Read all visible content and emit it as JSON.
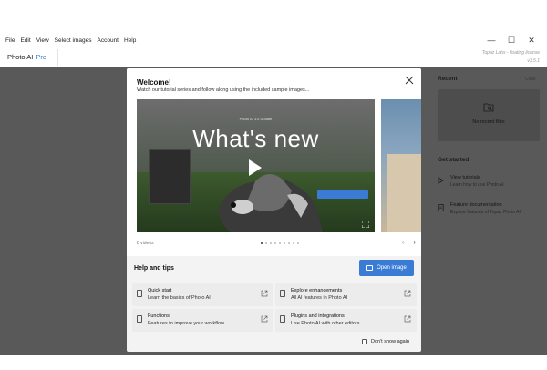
{
  "menu": [
    "File",
    "Edit",
    "View",
    "Select images",
    "Account",
    "Help"
  ],
  "window_controls": {
    "minimize": "—",
    "maximize": "☐",
    "close": "✕"
  },
  "app": {
    "name": "Photo AI",
    "tier": "Pro",
    "license_line1": "Topaz Labs - floating license",
    "license_line2": "v3.5.1"
  },
  "modal": {
    "title": "Welcome!",
    "subtitle": "Watch our tutorial series and follow along using the included sample images...",
    "video": {
      "small_caption": "Photo AI 3.5      Update",
      "headline": "What's new"
    },
    "video_count": "8 videos",
    "carousel": {
      "total": 9,
      "active": 0
    },
    "help_title": "Help and tips",
    "open_image": "Open image",
    "cards": [
      {
        "title": "Quick start",
        "desc": "Learn the basics of Photo AI"
      },
      {
        "title": "Explore enhancements",
        "desc": "All AI features in Photo AI"
      },
      {
        "title": "Functions",
        "desc": "Features to improve your workflow"
      },
      {
        "title": "Plugins and integrations",
        "desc": "Use Photo AI with other editors"
      }
    ],
    "dont_show": "Don't show again"
  },
  "right_panel": {
    "recent_title": "Recent",
    "clear": "Clear",
    "no_recent": "No recent files",
    "get_started": "Get started",
    "items": [
      {
        "title": "View tutorials",
        "desc": "Learn how to use Photo AI"
      },
      {
        "title": "Feature documentation",
        "desc": "Explore features of Topaz Photo AI"
      }
    ]
  }
}
